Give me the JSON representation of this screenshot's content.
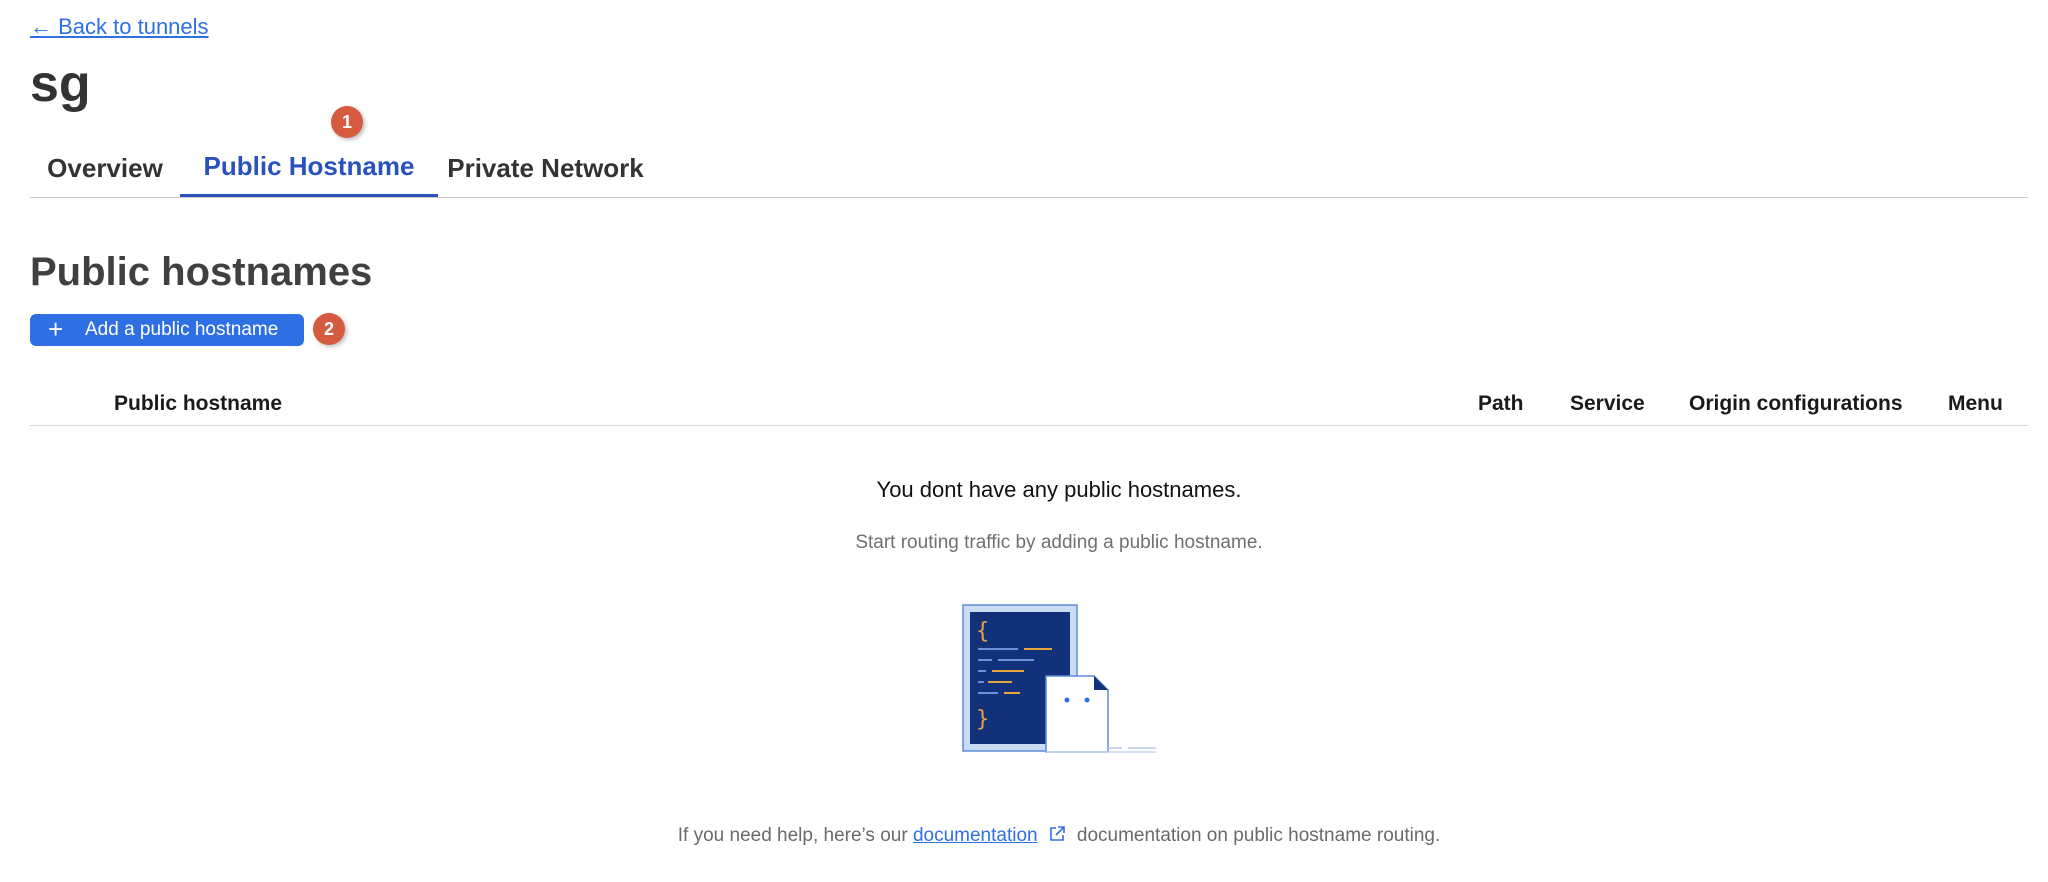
{
  "nav": {
    "back_label": "← Back to tunnels"
  },
  "page": {
    "title": "sg"
  },
  "tabs": [
    {
      "label": "Overview",
      "active": false
    },
    {
      "label": "Public Hostname",
      "active": true
    },
    {
      "label": "Private Network",
      "active": false
    }
  ],
  "badges": {
    "step1": "1",
    "step2": "2"
  },
  "section": {
    "title": "Public hostnames",
    "add_button_label": "Add a public hostname",
    "add_button_icon": "plus-icon"
  },
  "table": {
    "columns": [
      "Public hostname",
      "Path",
      "Service",
      "Origin configurations",
      "Menu"
    ]
  },
  "empty_state": {
    "title": "You dont have any public hostnames.",
    "subtitle": "Start routing traffic by adding a public hostname.",
    "illustration": "code-document-icon"
  },
  "help": {
    "prefix": "If you need help, here’s our ",
    "link_label": "documentation",
    "link_icon": "external-link-icon",
    "suffix": " documentation on public hostname routing."
  },
  "colors": {
    "accent": "#2f6fe4",
    "active_tab": "#2a52be",
    "badge": "#d65a3f",
    "illustration_navy": "#13307a"
  }
}
